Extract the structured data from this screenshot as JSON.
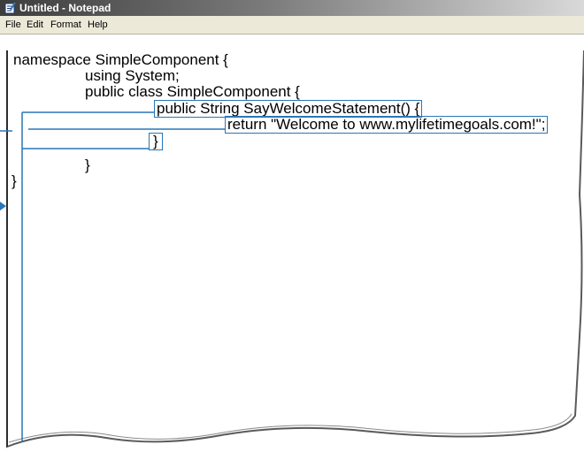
{
  "window": {
    "title": "Untitled - Notepad"
  },
  "menu": {
    "items": [
      "File",
      "Edit",
      "Format",
      "Help"
    ]
  },
  "code": {
    "line1": "namespace SimpleComponent {",
    "line2": "using System;",
    "line3": "public class SimpleComponent {",
    "line4": "public String SayWelcomeStatement() {",
    "line5": "return \"Welcome to www.mylifetimegoals.com!\";",
    "line6": "}",
    "line7": "}",
    "line8": "}"
  },
  "colors": {
    "callout": "#2a76b8",
    "title_gradient_start": "#3d3d3d",
    "menu_bg": "#ece9d8"
  },
  "icons": {
    "app": "notepad-icon"
  }
}
